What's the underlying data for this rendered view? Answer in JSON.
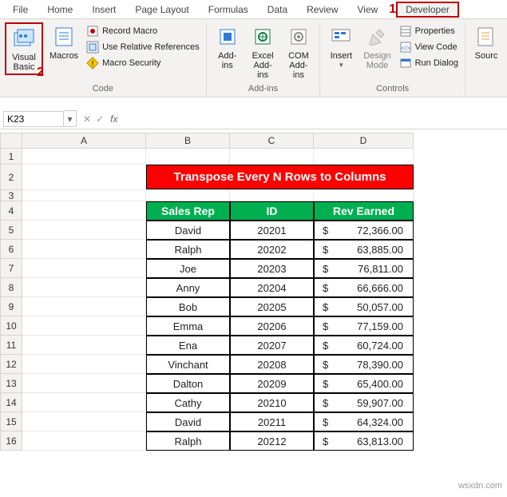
{
  "tabs": {
    "file": "File",
    "home": "Home",
    "insert": "Insert",
    "page_layout": "Page Layout",
    "formulas": "Formulas",
    "data": "Data",
    "review": "Review",
    "view": "View",
    "developer": "Developer"
  },
  "annotations": {
    "one": "1",
    "two": "2"
  },
  "ribbon": {
    "vb": "Visual\nBasic",
    "macros": "Macros",
    "record": "Record Macro",
    "userel": "Use Relative References",
    "security": "Macro Security",
    "code_group": "Code",
    "addins": "Add-\nins",
    "excel_addins": "Excel\nAdd-ins",
    "com_addins": "COM\nAdd-ins",
    "addins_group": "Add-ins",
    "insert": "Insert",
    "design": "Design\nMode",
    "properties": "Properties",
    "viewcode": "View Code",
    "rundialog": "Run Dialog",
    "controls_group": "Controls",
    "source": "Sourc"
  },
  "namebox": "K23",
  "fx": "fx",
  "columns": [
    "A",
    "B",
    "C",
    "D"
  ],
  "title": "Transpose Every N Rows to Columns",
  "headers": {
    "rep": "Sales Rep",
    "id": "ID",
    "rev": "Rev Earned"
  },
  "rows": [
    {
      "n": "5",
      "rep": "David",
      "id": "20201",
      "cur": "$",
      "rev": "72,366.00"
    },
    {
      "n": "6",
      "rep": "Ralph",
      "id": "20202",
      "cur": "$",
      "rev": "63,885.00"
    },
    {
      "n": "7",
      "rep": "Joe",
      "id": "20203",
      "cur": "$",
      "rev": "76,811.00"
    },
    {
      "n": "8",
      "rep": "Anny",
      "id": "20204",
      "cur": "$",
      "rev": "66,666.00"
    },
    {
      "n": "9",
      "rep": "Bob",
      "id": "20205",
      "cur": "$",
      "rev": "50,057.00"
    },
    {
      "n": "10",
      "rep": "Emma",
      "id": "20206",
      "cur": "$",
      "rev": "77,159.00"
    },
    {
      "n": "11",
      "rep": "Ena",
      "id": "20207",
      "cur": "$",
      "rev": "60,724.00"
    },
    {
      "n": "12",
      "rep": "Vinchant",
      "id": "20208",
      "cur": "$",
      "rev": "78,390.00"
    },
    {
      "n": "13",
      "rep": "Dalton",
      "id": "20209",
      "cur": "$",
      "rev": "65,400.00"
    },
    {
      "n": "14",
      "rep": "Cathy",
      "id": "20210",
      "cur": "$",
      "rev": "59,907.00"
    },
    {
      "n": "15",
      "rep": "David",
      "id": "20211",
      "cur": "$",
      "rev": "64,324.00"
    },
    {
      "n": "16",
      "rep": "Ralph",
      "id": "20212",
      "cur": "$",
      "rev": "63,813.00"
    }
  ],
  "watermark": "wsxdn.com"
}
